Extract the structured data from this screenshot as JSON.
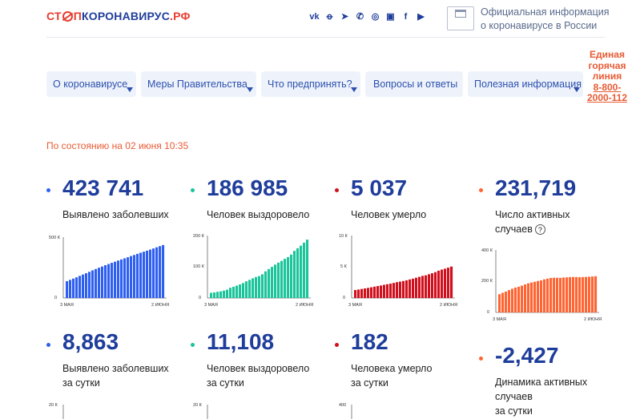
{
  "header": {
    "logo": {
      "part1": "СТ",
      "part2": "П",
      "part3": "КОРОНАВИРУС",
      "part4": ".РФ"
    },
    "social_icons": [
      "vk-icon",
      "ok-icon",
      "telegram-icon",
      "viber-icon",
      "whatsapp-icon",
      "instagram-icon",
      "facebook-icon",
      "youtube-icon"
    ],
    "gov_line1": "Официальная информация",
    "gov_line2": "о коронавирусе в России"
  },
  "nav": {
    "items": [
      {
        "label": "О коронавирусе"
      },
      {
        "label": "Меры Правительства"
      },
      {
        "label": "Что предпринять?"
      },
      {
        "label": "Вопросы и ответы"
      },
      {
        "label": "Полезная информация"
      }
    ]
  },
  "hotline": {
    "line1": "Единая",
    "line2": "горячая",
    "line3": "линия",
    "number": "8-800-2000-112"
  },
  "status": "По состоянию на 02 июня 10:35",
  "colors": {
    "blue": "#2f5ff0",
    "green": "#1cc49b",
    "red": "#d0101d",
    "orange": "#ff6433",
    "text_blue": "#1f3d9b"
  },
  "stats": [
    {
      "value": "423 741",
      "label": "Выявлено заболевших",
      "ytop": "500 К",
      "ymid": "",
      "yzero": "0",
      "x_start": "3 МАЯ",
      "x_end": "2 ИЮНЯ"
    },
    {
      "value": "186 985",
      "label": "Человек выздоровело",
      "ytop": "200 К",
      "ymid": "100 К",
      "yzero": "0",
      "x_start": "3 МАЯ",
      "x_end": "2 ИЮНЯ"
    },
    {
      "value": "5 037",
      "label": "Человек умерло",
      "ytop": "10 К",
      "ymid": "5 К",
      "yzero": "0",
      "x_start": "3 МАЯ",
      "x_end": "2 ИЮНЯ"
    },
    {
      "value": "231,719",
      "label1": "Число активных",
      "label2": "случаев",
      "ytop": "400 К",
      "ymid": "200 К",
      "yzero": "0",
      "x_start": "3 МАЯ",
      "x_end": "2 ИЮНЯ"
    }
  ],
  "daily": [
    {
      "value": "8,863",
      "label1": "Выявлено заболевших",
      "label2": "за сутки",
      "ytop": "20 К"
    },
    {
      "value": "11,108",
      "label1": "Человек выздоровело",
      "label2": "за сутки",
      "ytop": "20 К"
    },
    {
      "value": "182",
      "label1": "Человека умерло",
      "label2": "за сутки",
      "ytop": "400"
    },
    {
      "value": "-2,427",
      "label1": "Динамика активных",
      "label2": "случаев",
      "label3": "за сутки"
    }
  ],
  "chart_data": [
    {
      "type": "bar",
      "title": "Выявлено заболевших",
      "x_start": "3 МАЯ",
      "x_end": "2 ИЮНЯ",
      "ylim": [
        0,
        500000
      ],
      "color": "#2f5ff0",
      "values": [
        134687,
        145268,
        155370,
        165929,
        177160,
        187859,
        198676,
        209688,
        221344,
        232243,
        242271,
        252245,
        262843,
        272043,
        281752,
        290678,
        299941,
        308705,
        317554,
        326448,
        335882,
        344481,
        353427,
        362342,
        370680,
        379051,
        387623,
        396575,
        405843,
        414878,
        423741
      ]
    },
    {
      "type": "bar",
      "title": "Человек выздоровело",
      "x_start": "3 МАЯ",
      "x_end": "2 ИЮНЯ",
      "ylim": [
        0,
        200000
      ],
      "color": "#1cc49b",
      "values": [
        16639,
        18095,
        19865,
        21327,
        23803,
        26608,
        32900,
        36100,
        39800,
        43500,
        48000,
        53500,
        58200,
        63100,
        67300,
        70200,
        76100,
        85400,
        92700,
        99800,
        107000,
        113300,
        118800,
        125400,
        131100,
        139000,
        150900,
        159300,
        167500,
        177000,
        186985
      ]
    },
    {
      "type": "bar",
      "title": "Человек умерло",
      "x_start": "3 МАЯ",
      "x_end": "2 ИЮНЯ",
      "ylim": [
        0,
        10000
      ],
      "color": "#d0101d",
      "values": [
        1280,
        1356,
        1451,
        1537,
        1625,
        1723,
        1827,
        1915,
        2009,
        2116,
        2212,
        2305,
        2418,
        2537,
        2631,
        2722,
        2837,
        2972,
        3099,
        3249,
        3388,
        3541,
        3633,
        3807,
        3968,
        4142,
        4374,
        4555,
        4693,
        4855,
        5037
      ]
    },
    {
      "type": "bar",
      "title": "Число активных случаев",
      "x_start": "3 МАЯ",
      "x_end": "2 ИЮНЯ",
      "ylim": [
        0,
        400000
      ],
      "color": "#ff6433",
      "values": [
        116768,
        125817,
        134054,
        143065,
        151732,
        159528,
        164949,
        171673,
        179535,
        186627,
        192059,
        196440,
        201225,
        205406,
        211821,
        216756,
        220993,
        222261,
        221722,
        221399,
        223694,
        224556,
        226161,
        226902,
        226574,
        226012,
        226162,
        227294,
        228575,
        229934,
        231719
      ]
    }
  ]
}
